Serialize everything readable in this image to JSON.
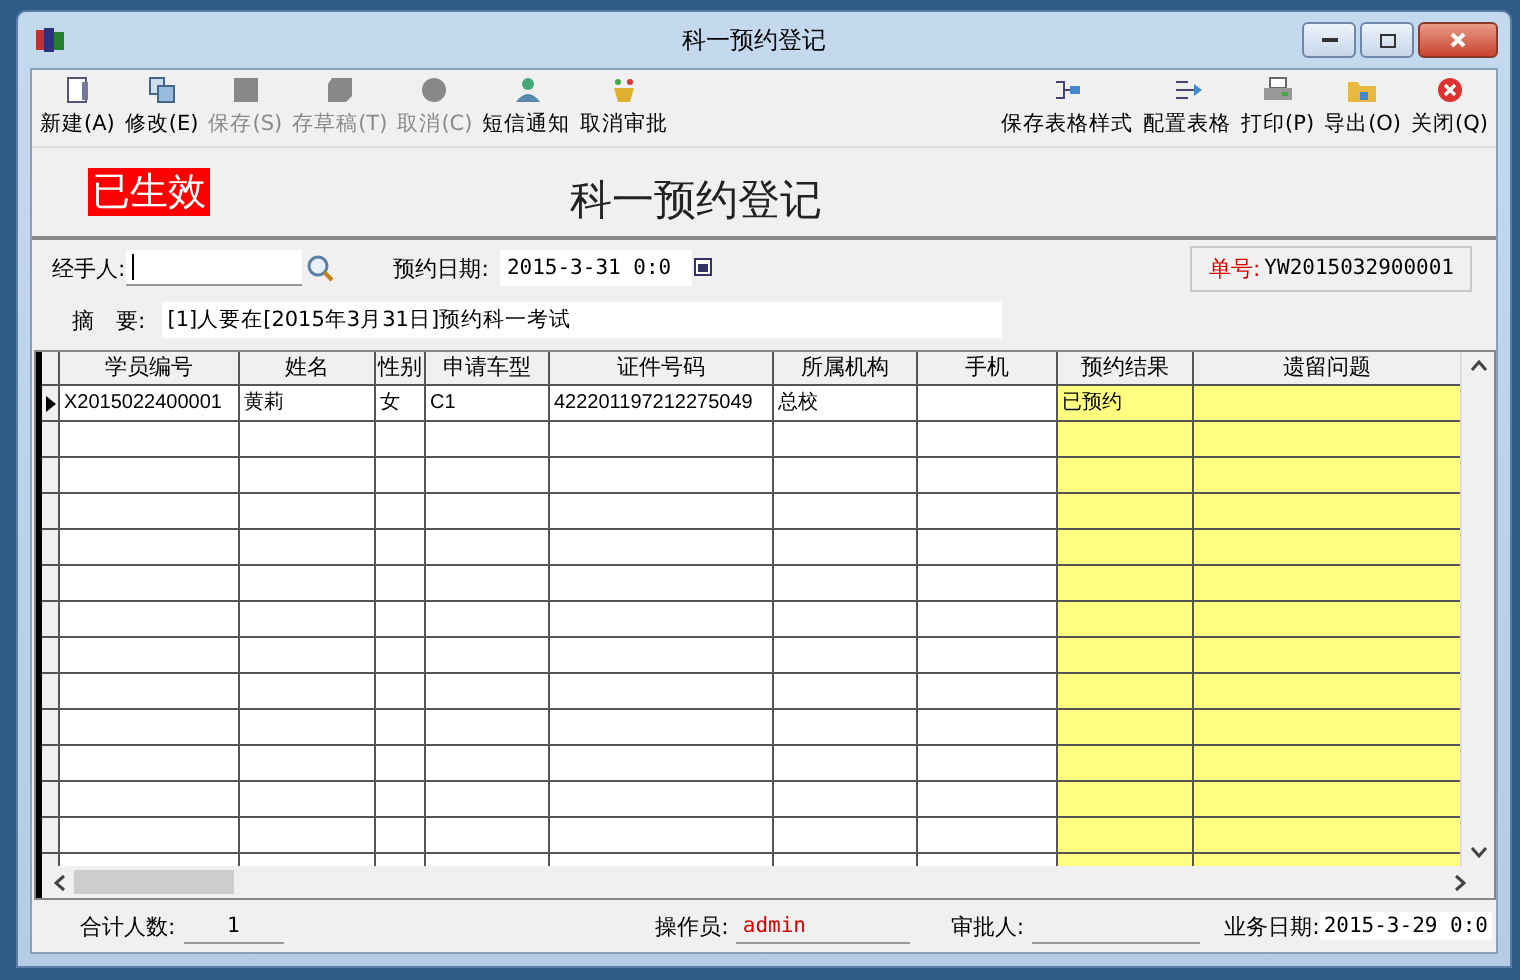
{
  "window": {
    "title": "科一预约登记"
  },
  "toolbar_left": [
    {
      "label": "新建(A)",
      "disabled": false
    },
    {
      "label": "修改(E)",
      "disabled": false
    },
    {
      "label": "保存(S)",
      "disabled": true
    },
    {
      "label": "存草稿(T)",
      "disabled": true
    },
    {
      "label": "取消(C)",
      "disabled": true
    },
    {
      "label": "短信通知",
      "disabled": false
    },
    {
      "label": "取消审批",
      "disabled": false
    }
  ],
  "toolbar_right": [
    {
      "label": "保存表格样式",
      "disabled": false
    },
    {
      "label": "配置表格",
      "disabled": false
    },
    {
      "label": "打印(P)",
      "disabled": false
    },
    {
      "label": "导出(O)",
      "disabled": false
    },
    {
      "label": "关闭(Q)",
      "disabled": false
    }
  ],
  "status_stamp": "已生效",
  "heading": "科一预约登记",
  "form": {
    "handler_label": "经手人:",
    "date_label": "预约日期:",
    "date_value": "2015-3-31 0:0",
    "order_label": "单号:",
    "order_value": "YW2015032900001",
    "summary_label": "摘　要:",
    "summary_value": "[1]人要在[2015年3月31日]预约科一考试"
  },
  "table": {
    "columns": [
      {
        "label": "学员编号",
        "highlight": false
      },
      {
        "label": "姓名",
        "highlight": false
      },
      {
        "label": "性别",
        "highlight": false
      },
      {
        "label": "申请车型",
        "highlight": false
      },
      {
        "label": "证件号码",
        "highlight": false
      },
      {
        "label": "所属机构",
        "highlight": false
      },
      {
        "label": "手机",
        "highlight": false
      },
      {
        "label": "预约结果",
        "highlight": true
      },
      {
        "label": "遗留问题",
        "highlight": true
      }
    ],
    "rows": [
      {
        "selected": true,
        "cells": [
          "X2015022400001",
          "黄莉",
          "女",
          "C1",
          "422201197212275049",
          "总校",
          "",
          "已预约",
          ""
        ]
      }
    ]
  },
  "footer": {
    "count_label": "合计人数:",
    "count_value": "1",
    "operator_label": "操作员:",
    "operator_value": "admin",
    "approver_label": "审批人:",
    "date_label": "业务日期:",
    "date_value": "2015-3-29 0:0"
  }
}
